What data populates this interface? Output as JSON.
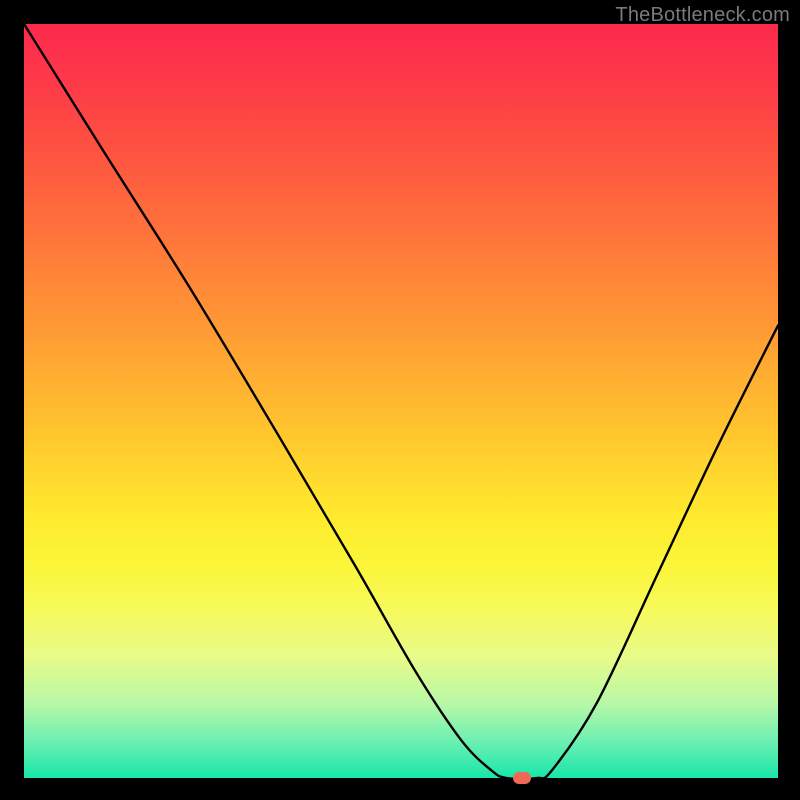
{
  "watermark": "TheBottleneck.com",
  "chart_data": {
    "type": "line",
    "title": "",
    "xlabel": "",
    "ylabel": "",
    "xlim": [
      0,
      100
    ],
    "ylim": [
      0,
      100
    ],
    "series": [
      {
        "name": "bottleneck-curve",
        "x": [
          0,
          10,
          22,
          34,
          44,
          52,
          58,
          62,
          64,
          68,
          70,
          76,
          84,
          92,
          100
        ],
        "values": [
          100,
          84,
          65,
          45,
          28,
          14,
          5,
          1,
          0,
          0,
          1,
          10,
          27,
          44,
          60
        ]
      }
    ],
    "marker": {
      "x": 66,
      "y": 0,
      "color": "#ef6756"
    },
    "gradient_stops": [
      {
        "pos": 0,
        "color": "#fc2a4d"
      },
      {
        "pos": 50,
        "color": "#ffc82e"
      },
      {
        "pos": 100,
        "color": "#18e6a9"
      }
    ]
  }
}
